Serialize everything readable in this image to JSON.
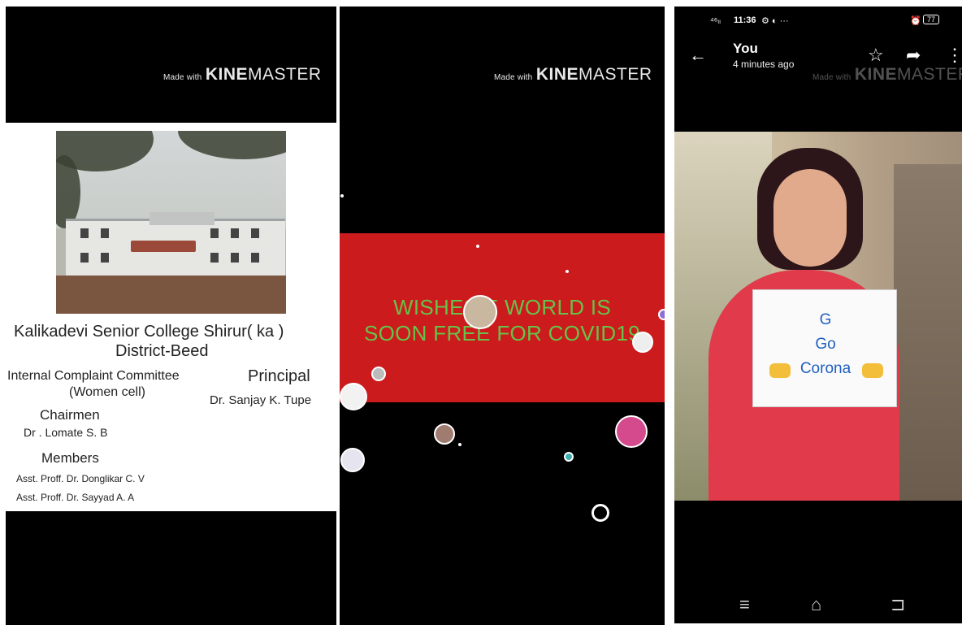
{
  "panel1": {
    "watermark": {
      "small": "Made with",
      "bold": "KINE",
      "light": "MASTER"
    },
    "college_name": "Kalikadevi Senior College Shirur( ka )",
    "district": "District-Beed",
    "committee_line1": "Internal Complaint Committee",
    "committee_line2": "(Women cell)",
    "principal_heading": "Principal",
    "principal_name": "Dr. Sanjay K. Tupe",
    "chairman_heading": "Chairmen",
    "chairman_name": "Dr . Lomate S. B",
    "members_heading": "Members",
    "members": [
      "Asst. Proff. Dr. Donglikar  C. V",
      "Asst. Proff. Dr. Sayyad A. A"
    ]
  },
  "panel2": {
    "watermark": {
      "small": "Made with",
      "bold": "KINE",
      "light": "MASTER"
    },
    "banner_line1": "WISHES      E WORLD IS",
    "banner_line2": "SOON FREE FOR COVID19",
    "colors": {
      "banner": "#cc1b1c",
      "text": "#66c24a"
    }
  },
  "panel3": {
    "status": {
      "signal": "⁴⁶ₗₗ",
      "time": "11:36",
      "extras": "⚙ ◐ ···",
      "alarm": "⏰",
      "battery": "77"
    },
    "title": "You",
    "subtitle": "4 minutes ago",
    "watermark": {
      "small": "Made with",
      "bold": "KINE",
      "light": "MASTER"
    },
    "sign_lines": [
      "G",
      "Go",
      "Corona"
    ],
    "icons": {
      "back": "back-arrow-icon",
      "star": "star-icon",
      "share": "share-icon",
      "more": "more-vert-icon"
    },
    "nav": {
      "menu": "≡",
      "home": "⌂",
      "back": "⊐"
    }
  }
}
